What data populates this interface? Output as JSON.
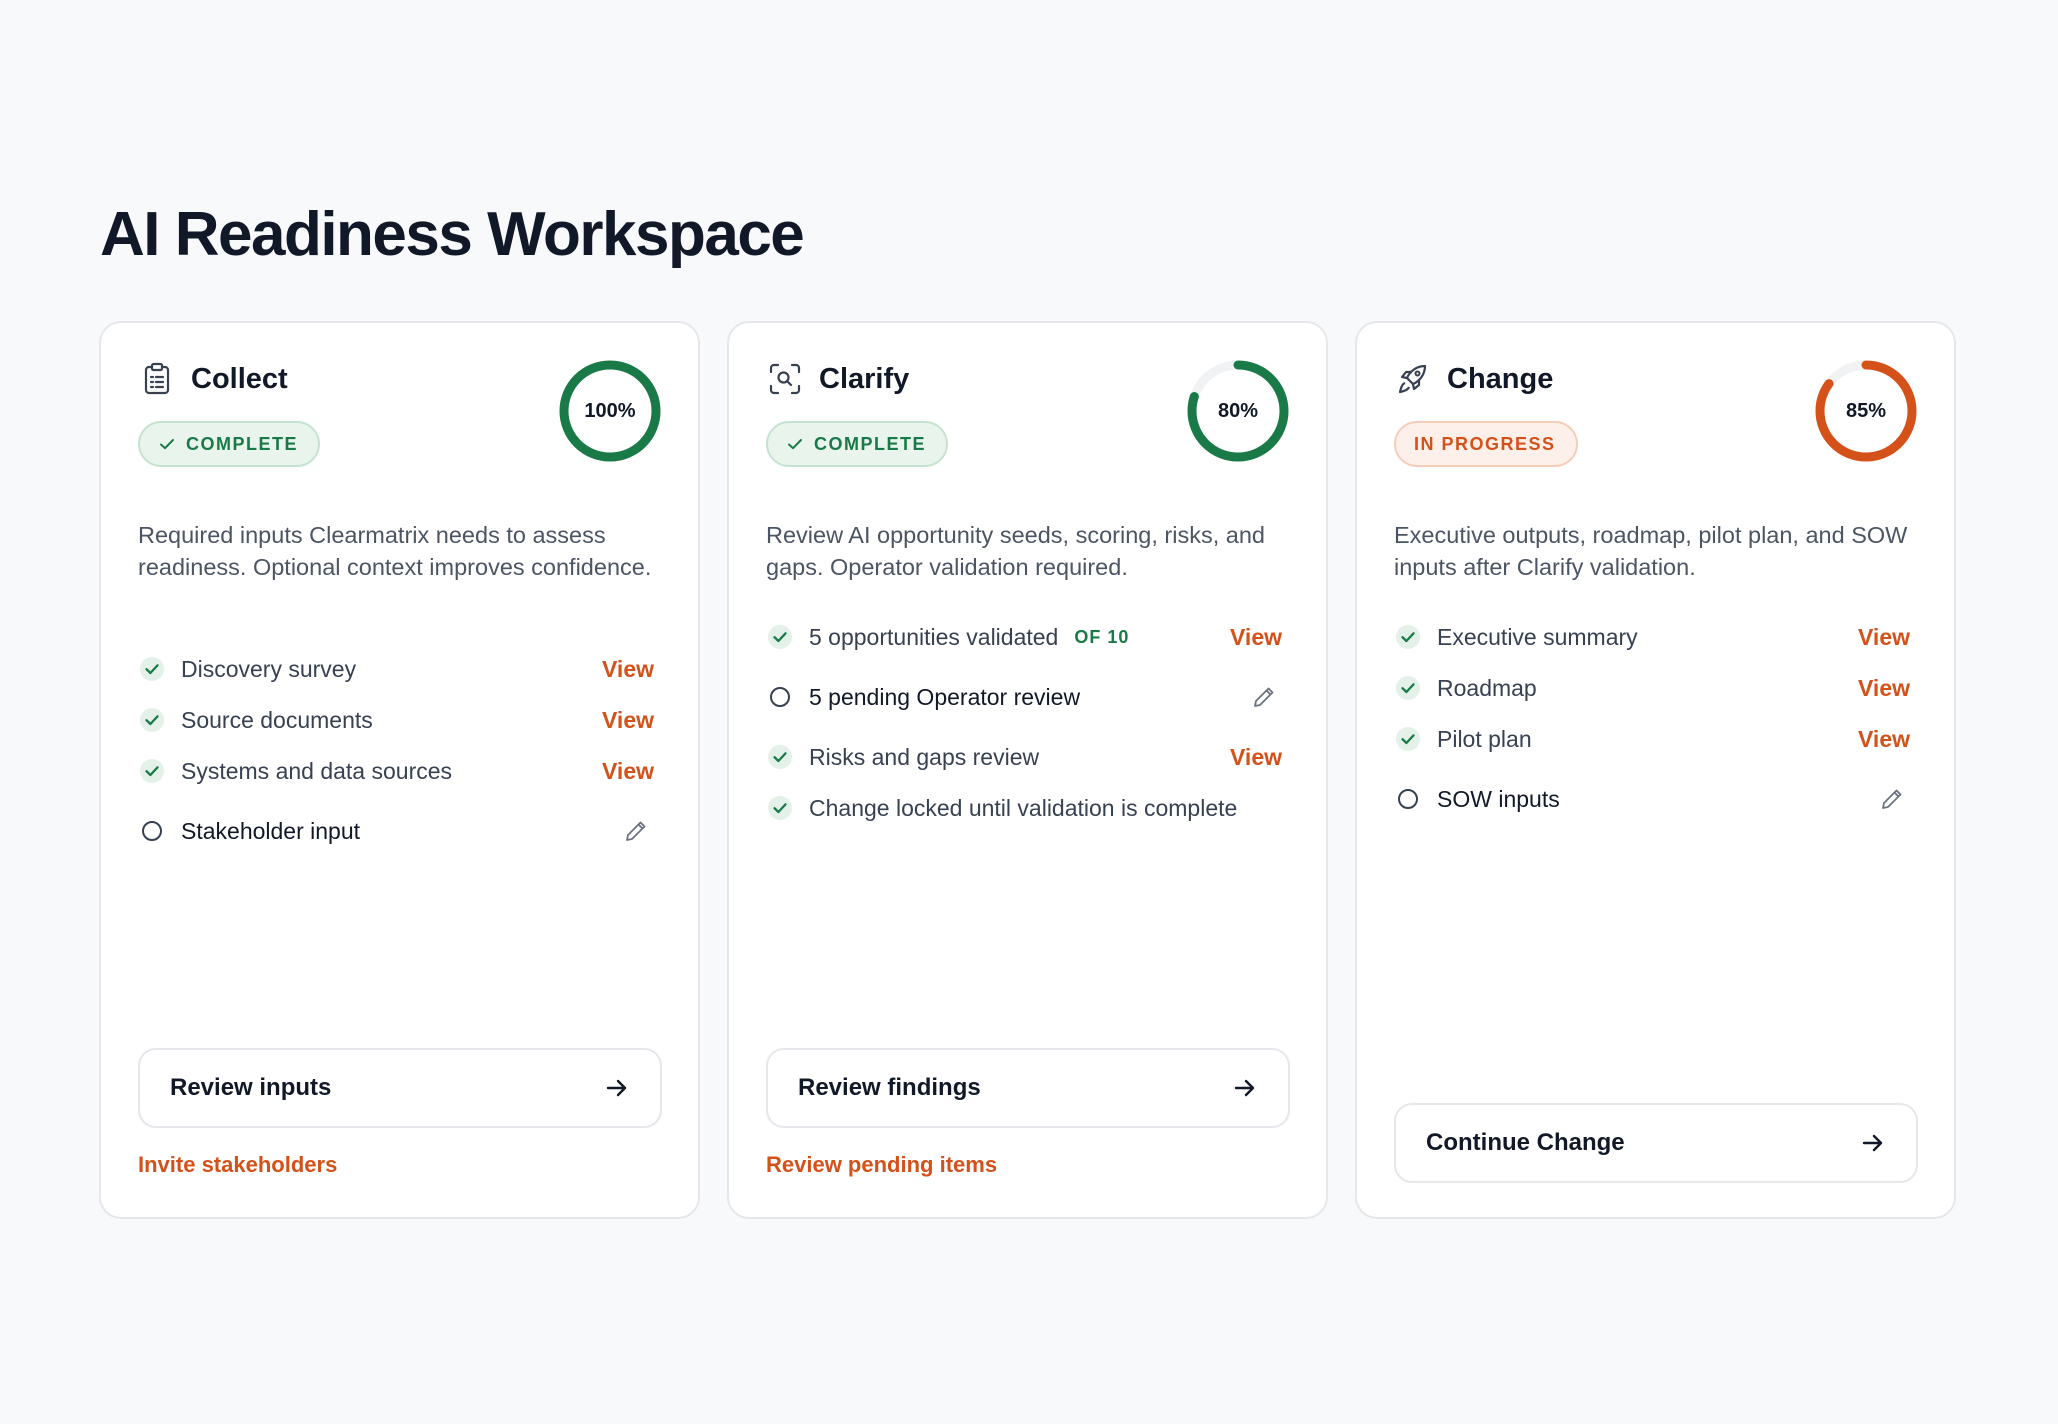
{
  "page": {
    "title": "AI Readiness Workspace"
  },
  "colors": {
    "green": "#1a7a47",
    "orange": "#d4521a",
    "track": "#f1f2f4"
  },
  "cards": [
    {
      "title": "Collect",
      "icon": "clipboard-list-icon",
      "badge": "COMPLETE",
      "badge_status": "complete",
      "progress": 100,
      "progress_label": "100%",
      "description": "Required inputs Clearmatrix needs to assess readiness. Optional context improves confidence.",
      "items": [
        {
          "label": "Discovery survey",
          "done": true,
          "action": "View"
        },
        {
          "label": "Source documents",
          "done": true,
          "action": "View"
        },
        {
          "label": "Systems and data sources",
          "done": true,
          "action": "View"
        },
        {
          "label": "Stakeholder input",
          "done": false,
          "action_icon": "pencil-icon"
        }
      ],
      "primary_button": "Review inputs",
      "secondary_link": "Invite stakeholders"
    },
    {
      "title": "Clarify",
      "icon": "scan-search-icon",
      "badge": "COMPLETE",
      "badge_status": "complete",
      "progress": 80,
      "progress_label": "80%",
      "description": "Review AI opportunity seeds, scoring, risks, and gaps. Operator validation required.",
      "items": [
        {
          "label": "5 opportunities validated",
          "count": "OF 10",
          "done": true,
          "action": "View"
        },
        {
          "label": "5 pending Operator review",
          "done": false,
          "action_icon": "pencil-icon"
        },
        {
          "label": "Risks and gaps review",
          "done": true,
          "action": "View"
        },
        {
          "label": "Change locked until validation is complete",
          "done": true
        }
      ],
      "primary_button": "Review findings",
      "secondary_link": "Review pending items"
    },
    {
      "title": "Change",
      "icon": "rocket-icon",
      "badge": "IN PROGRESS",
      "badge_status": "progress",
      "progress": 85,
      "progress_label": "85%",
      "description": "Executive outputs, roadmap, pilot plan, and SOW inputs after Clarify validation.",
      "items": [
        {
          "label": "Executive summary",
          "done": true,
          "action": "View"
        },
        {
          "label": "Roadmap",
          "done": true,
          "action": "View"
        },
        {
          "label": "Pilot plan",
          "done": true,
          "action": "View"
        },
        {
          "label": "SOW inputs",
          "done": false,
          "action_icon": "pencil-icon"
        }
      ],
      "primary_button": "Continue Change"
    }
  ]
}
